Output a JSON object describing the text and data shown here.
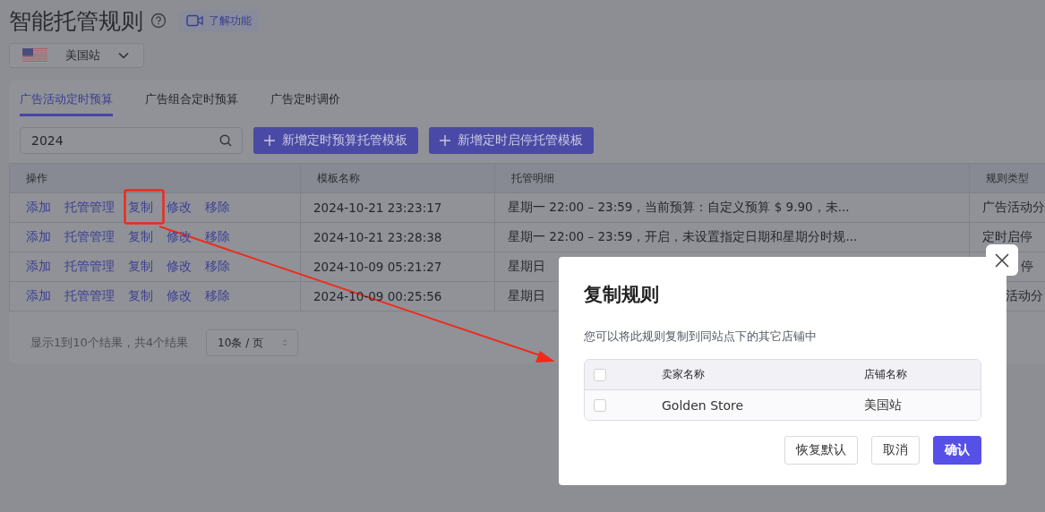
{
  "page": {
    "title": "智能托管规则",
    "learn_button": "了解功能",
    "site_select": "美国站"
  },
  "tabs": [
    {
      "label": "广告活动定时预算",
      "selected": true
    },
    {
      "label": "广告组合定时预算",
      "selected": false
    },
    {
      "label": "广告定时调价",
      "selected": false
    }
  ],
  "search": {
    "value": "2024"
  },
  "buttons": [
    "新增定时预算托管模板",
    "新增定时启停托管模板"
  ],
  "table": {
    "columns": [
      "操作",
      "模板名称",
      "托管明细",
      "规则类型"
    ],
    "rows": [
      {
        "actions": [
          "添加",
          "托管管理",
          "复制",
          "修改",
          "移除"
        ],
        "name": "2024-10-21 23:23:17",
        "detail": "星期一  22:00 – 23:59，当前预算：自定义预算 $ 9.90，未...",
        "type": "广告活动分"
      },
      {
        "actions": [
          "添加",
          "托管管理",
          "复制",
          "修改",
          "移除"
        ],
        "name": "2024-10-21 23:28:38",
        "detail": "星期一  22:00 – 23:59，开启，未设置指定日期和星期分时规...",
        "type": "定时启停"
      },
      {
        "actions": [
          "添加",
          "托管管理",
          "复制",
          "修改",
          "移除"
        ],
        "name": "2024-10-09 05:21:27",
        "detail": "星期日",
        "type": "停"
      },
      {
        "actions": [
          "添加",
          "托管管理",
          "复制",
          "修改",
          "移除"
        ],
        "name": "2024-10-09 00:25:56",
        "detail": "星期日",
        "type": "活动分"
      }
    ]
  },
  "footer": {
    "summary": "显示1到10个结果，共4个结果",
    "page_size": "10条 / 页"
  },
  "dialog": {
    "title": "复制规则",
    "description": "您可以将此规则复制到同站点下的其它店铺中",
    "columns": [
      "卖家名称",
      "店铺名称"
    ],
    "header_checked": false,
    "rows": [
      {
        "seller": "Golden Store",
        "store": "美国站",
        "checked": false
      }
    ],
    "buttons": [
      {
        "label": "恢复默认",
        "kind": "default"
      },
      {
        "label": "取消",
        "kind": "default"
      },
      {
        "label": "确认",
        "kind": "primary"
      }
    ]
  }
}
